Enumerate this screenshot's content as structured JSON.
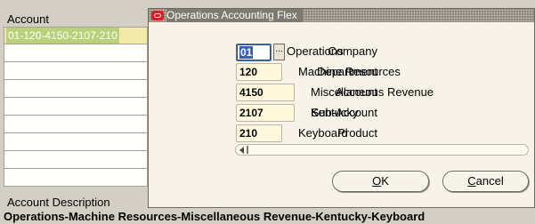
{
  "background": {
    "account_header": "Account",
    "account_rows": [
      "01-120-4150-2107-210",
      "",
      "",
      "",
      "",
      "",
      "",
      "",
      ""
    ],
    "description_label": "Account Description",
    "description_value": "Operations-Machine Resources-Miscellaneous Revenue-Kentucky-Keyboard"
  },
  "dialog": {
    "title": "Operations Accounting Flex",
    "segments": [
      {
        "label": "Company",
        "value": "01",
        "description": "Operations"
      },
      {
        "label": "Department",
        "value": "120",
        "description": "Machine Resources"
      },
      {
        "label": "Account",
        "value": "4150",
        "description": "Miscellaneous Revenue"
      },
      {
        "label": "Sub-Account",
        "value": "2107",
        "description": "Kentucky"
      },
      {
        "label": "Product",
        "value": "210",
        "description": "Keyboard"
      }
    ],
    "lov_label": "...",
    "ok_prefix": "",
    "ok_mnemonic": "O",
    "ok_rest": "K",
    "cancel_mnemonic": "C",
    "cancel_rest": "ancel"
  },
  "colors": {
    "focus": "#3a5fb0",
    "field_bg": "#fff8dc",
    "title_bar": "#7f7a70",
    "oracle_red": "#d52222"
  }
}
